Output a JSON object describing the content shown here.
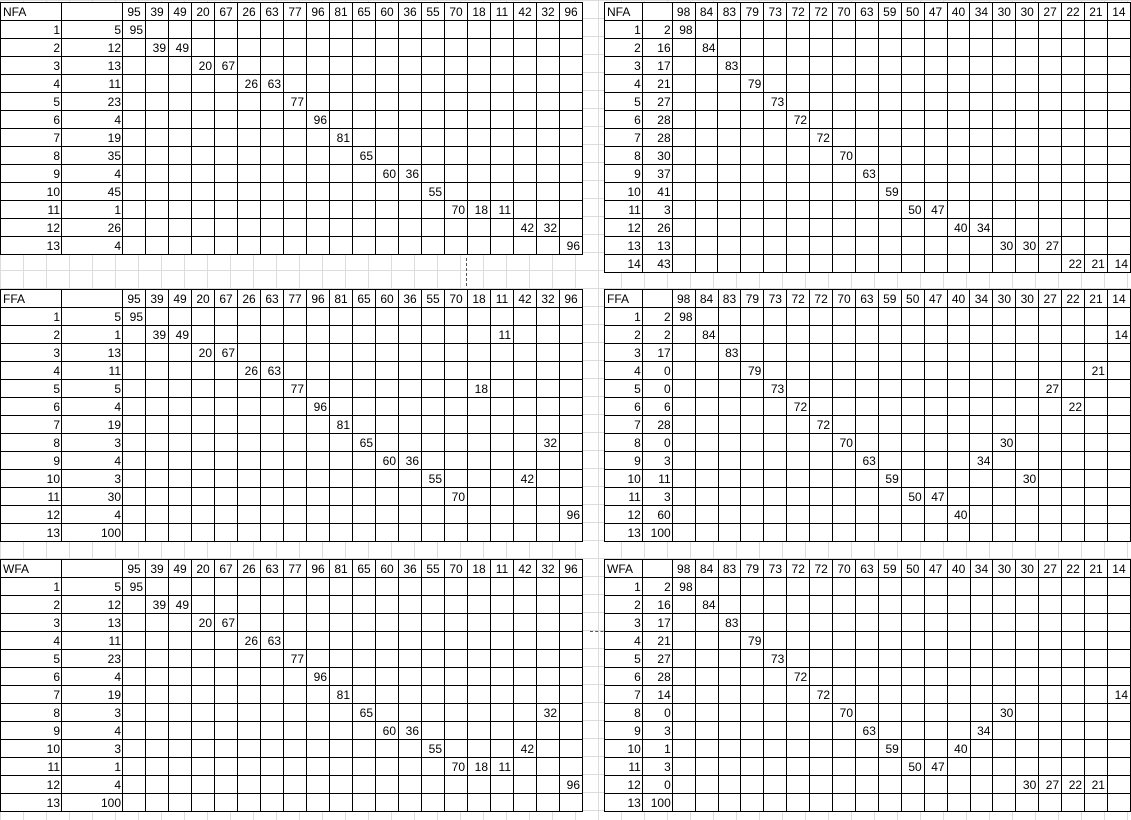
{
  "left_headers": [
    "95",
    "39",
    "49",
    "20",
    "67",
    "26",
    "63",
    "77",
    "96",
    "81",
    "65",
    "60",
    "36",
    "55",
    "70",
    "18",
    "11",
    "42",
    "32",
    "96"
  ],
  "right_headers": [
    "98",
    "84",
    "83",
    "79",
    "73",
    "72",
    "72",
    "70",
    "63",
    "59",
    "50",
    "47",
    "40",
    "34",
    "30",
    "30",
    "27",
    "22",
    "21",
    "14"
  ],
  "tables": [
    {
      "label": "NFA",
      "rows": [
        {
          "id": "1",
          "val": "5",
          "cells": {
            "0": "95"
          }
        },
        {
          "id": "2",
          "val": "12",
          "cells": {
            "1": "39",
            "2": "49"
          }
        },
        {
          "id": "3",
          "val": "13",
          "cells": {
            "3": "20",
            "4": "67"
          }
        },
        {
          "id": "4",
          "val": "11",
          "cells": {
            "5": "26",
            "6": "63"
          }
        },
        {
          "id": "5",
          "val": "23",
          "cells": {
            "7": "77"
          }
        },
        {
          "id": "6",
          "val": "4",
          "cells": {
            "8": "96"
          }
        },
        {
          "id": "7",
          "val": "19",
          "cells": {
            "9": "81"
          }
        },
        {
          "id": "8",
          "val": "35",
          "cells": {
            "10": "65"
          }
        },
        {
          "id": "9",
          "val": "4",
          "cells": {
            "11": "60",
            "12": "36"
          }
        },
        {
          "id": "10",
          "val": "45",
          "cells": {
            "13": "55"
          }
        },
        {
          "id": "11",
          "val": "1",
          "cells": {
            "14": "70",
            "15": "18",
            "16": "11"
          }
        },
        {
          "id": "12",
          "val": "26",
          "cells": {
            "17": "42",
            "18": "32"
          }
        },
        {
          "id": "13",
          "val": "4",
          "cells": {
            "19": "96"
          }
        }
      ]
    },
    {
      "label": "NFA",
      "rows": [
        {
          "id": "1",
          "val": "2",
          "cells": {
            "0": "98"
          }
        },
        {
          "id": "2",
          "val": "16",
          "cells": {
            "1": "84"
          }
        },
        {
          "id": "3",
          "val": "17",
          "cells": {
            "2": "83"
          }
        },
        {
          "id": "4",
          "val": "21",
          "cells": {
            "3": "79"
          }
        },
        {
          "id": "5",
          "val": "27",
          "cells": {
            "4": "73"
          }
        },
        {
          "id": "6",
          "val": "28",
          "cells": {
            "5": "72"
          }
        },
        {
          "id": "7",
          "val": "28",
          "cells": {
            "6": "72"
          }
        },
        {
          "id": "8",
          "val": "30",
          "cells": {
            "7": "70"
          }
        },
        {
          "id": "9",
          "val": "37",
          "cells": {
            "8": "63"
          }
        },
        {
          "id": "10",
          "val": "41",
          "cells": {
            "9": "59"
          }
        },
        {
          "id": "11",
          "val": "3",
          "cells": {
            "10": "50",
            "11": "47"
          }
        },
        {
          "id": "12",
          "val": "26",
          "cells": {
            "12": "40",
            "13": "34"
          }
        },
        {
          "id": "13",
          "val": "13",
          "cells": {
            "14": "30",
            "15": "30",
            "16": "27"
          }
        },
        {
          "id": "14",
          "val": "43",
          "cells": {
            "17": "22",
            "18": "21",
            "19": "14"
          }
        }
      ]
    },
    {
      "label": "FFA",
      "rows": [
        {
          "id": "1",
          "val": "5",
          "cells": {
            "0": "95"
          }
        },
        {
          "id": "2",
          "val": "1",
          "cells": {
            "1": "39",
            "2": "49",
            "16": "11"
          }
        },
        {
          "id": "3",
          "val": "13",
          "cells": {
            "3": "20",
            "4": "67"
          }
        },
        {
          "id": "4",
          "val": "11",
          "cells": {
            "5": "26",
            "6": "63"
          }
        },
        {
          "id": "5",
          "val": "5",
          "cells": {
            "7": "77",
            "15": "18"
          }
        },
        {
          "id": "6",
          "val": "4",
          "cells": {
            "8": "96"
          }
        },
        {
          "id": "7",
          "val": "19",
          "cells": {
            "9": "81"
          }
        },
        {
          "id": "8",
          "val": "3",
          "cells": {
            "10": "65",
            "18": "32"
          }
        },
        {
          "id": "9",
          "val": "4",
          "cells": {
            "11": "60",
            "12": "36"
          }
        },
        {
          "id": "10",
          "val": "3",
          "cells": {
            "13": "55",
            "17": "42"
          }
        },
        {
          "id": "11",
          "val": "30",
          "cells": {
            "14": "70"
          }
        },
        {
          "id": "12",
          "val": "4",
          "cells": {
            "19": "96"
          }
        },
        {
          "id": "13",
          "val": "100",
          "cells": {}
        }
      ]
    },
    {
      "label": "FFA",
      "rows": [
        {
          "id": "1",
          "val": "2",
          "cells": {
            "0": "98"
          }
        },
        {
          "id": "2",
          "val": "2",
          "cells": {
            "1": "84",
            "19": "14"
          }
        },
        {
          "id": "3",
          "val": "17",
          "cells": {
            "2": "83"
          }
        },
        {
          "id": "4",
          "val": "0",
          "cells": {
            "3": "79",
            "18": "21"
          }
        },
        {
          "id": "5",
          "val": "0",
          "cells": {
            "4": "73",
            "16": "27"
          }
        },
        {
          "id": "6",
          "val": "6",
          "cells": {
            "5": "72",
            "17": "22"
          }
        },
        {
          "id": "7",
          "val": "28",
          "cells": {
            "6": "72"
          }
        },
        {
          "id": "8",
          "val": "0",
          "cells": {
            "7": "70",
            "14": "30"
          }
        },
        {
          "id": "9",
          "val": "3",
          "cells": {
            "8": "63",
            "13": "34"
          }
        },
        {
          "id": "10",
          "val": "11",
          "cells": {
            "9": "59",
            "15": "30"
          }
        },
        {
          "id": "11",
          "val": "3",
          "cells": {
            "10": "50",
            "11": "47"
          }
        },
        {
          "id": "12",
          "val": "60",
          "cells": {
            "12": "40"
          }
        },
        {
          "id": "13",
          "val": "100",
          "cells": {}
        }
      ]
    },
    {
      "label": "WFA",
      "rows": [
        {
          "id": "1",
          "val": "5",
          "cells": {
            "0": "95"
          }
        },
        {
          "id": "2",
          "val": "12",
          "cells": {
            "1": "39",
            "2": "49"
          }
        },
        {
          "id": "3",
          "val": "13",
          "cells": {
            "3": "20",
            "4": "67"
          }
        },
        {
          "id": "4",
          "val": "11",
          "cells": {
            "5": "26",
            "6": "63"
          }
        },
        {
          "id": "5",
          "val": "23",
          "cells": {
            "7": "77"
          }
        },
        {
          "id": "6",
          "val": "4",
          "cells": {
            "8": "96"
          }
        },
        {
          "id": "7",
          "val": "19",
          "cells": {
            "9": "81"
          }
        },
        {
          "id": "8",
          "val": "3",
          "cells": {
            "10": "65",
            "18": "32"
          }
        },
        {
          "id": "9",
          "val": "4",
          "cells": {
            "11": "60",
            "12": "36"
          }
        },
        {
          "id": "10",
          "val": "3",
          "cells": {
            "13": "55",
            "17": "42"
          }
        },
        {
          "id": "11",
          "val": "1",
          "cells": {
            "14": "70",
            "15": "18",
            "16": "11"
          }
        },
        {
          "id": "12",
          "val": "4",
          "cells": {
            "19": "96"
          }
        },
        {
          "id": "13",
          "val": "100",
          "cells": {}
        }
      ]
    },
    {
      "label": "WFA",
      "rows": [
        {
          "id": "1",
          "val": "2",
          "cells": {
            "0": "98"
          }
        },
        {
          "id": "2",
          "val": "16",
          "cells": {
            "1": "84"
          }
        },
        {
          "id": "3",
          "val": "17",
          "cells": {
            "2": "83"
          }
        },
        {
          "id": "4",
          "val": "21",
          "cells": {
            "3": "79"
          }
        },
        {
          "id": "5",
          "val": "27",
          "cells": {
            "4": "73"
          }
        },
        {
          "id": "6",
          "val": "28",
          "cells": {
            "5": "72"
          }
        },
        {
          "id": "7",
          "val": "14",
          "cells": {
            "6": "72",
            "19": "14"
          }
        },
        {
          "id": "8",
          "val": "0",
          "cells": {
            "7": "70",
            "14": "30"
          }
        },
        {
          "id": "9",
          "val": "3",
          "cells": {
            "8": "63",
            "13": "34"
          }
        },
        {
          "id": "10",
          "val": "1",
          "cells": {
            "9": "59",
            "12": "40"
          }
        },
        {
          "id": "11",
          "val": "3",
          "cells": {
            "10": "50",
            "11": "47"
          }
        },
        {
          "id": "12",
          "val": "0",
          "cells": {
            "15": "30",
            "16": "27",
            "17": "22",
            "18": "21"
          }
        },
        {
          "id": "13",
          "val": "100",
          "cells": {}
        }
      ]
    }
  ]
}
